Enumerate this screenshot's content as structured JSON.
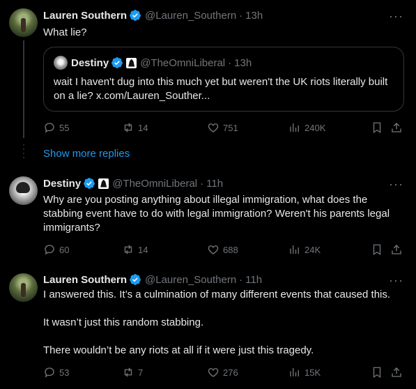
{
  "tweets": [
    {
      "name": "Lauren Southern",
      "handle": "@Lauren_Southern",
      "time": "13h",
      "text": [
        "What lie?"
      ],
      "quote": {
        "name": "Destiny",
        "handle": "@TheOmniLiberal",
        "time": "13h",
        "text": "wait I haven't dug into this much yet but weren't the UK riots literally built on a lie? x.com/Lauren_Souther..."
      },
      "stats": {
        "replies": "55",
        "reposts": "14",
        "likes": "751",
        "views": "240K"
      }
    },
    {
      "name": "Destiny",
      "handle": "@TheOmniLiberal",
      "time": "11h",
      "text": [
        "Why are you posting anything about illegal immigration, what does the stabbing event have to do with legal immigration? Weren't his parents legal immigrants?"
      ],
      "stats": {
        "replies": "60",
        "reposts": "14",
        "likes": "688",
        "views": "24K"
      }
    },
    {
      "name": "Lauren Southern",
      "handle": "@Lauren_Southern",
      "time": "11h",
      "text": [
        "I answered this. It’s a culmination of many different events that caused this.",
        "It wasn’t just this random stabbing.",
        "There wouldn’t be any riots at all if it were just this tragedy."
      ],
      "stats": {
        "replies": "53",
        "reposts": "7",
        "likes": "276",
        "views": "15K"
      }
    }
  ],
  "show_more": "Show more replies",
  "dot": "·",
  "more_glyph": "···",
  "colors": {
    "background": "#000000",
    "text": "#e7e9ea",
    "muted": "#71767b",
    "accent": "#1d9bf0",
    "border": "#333639"
  }
}
